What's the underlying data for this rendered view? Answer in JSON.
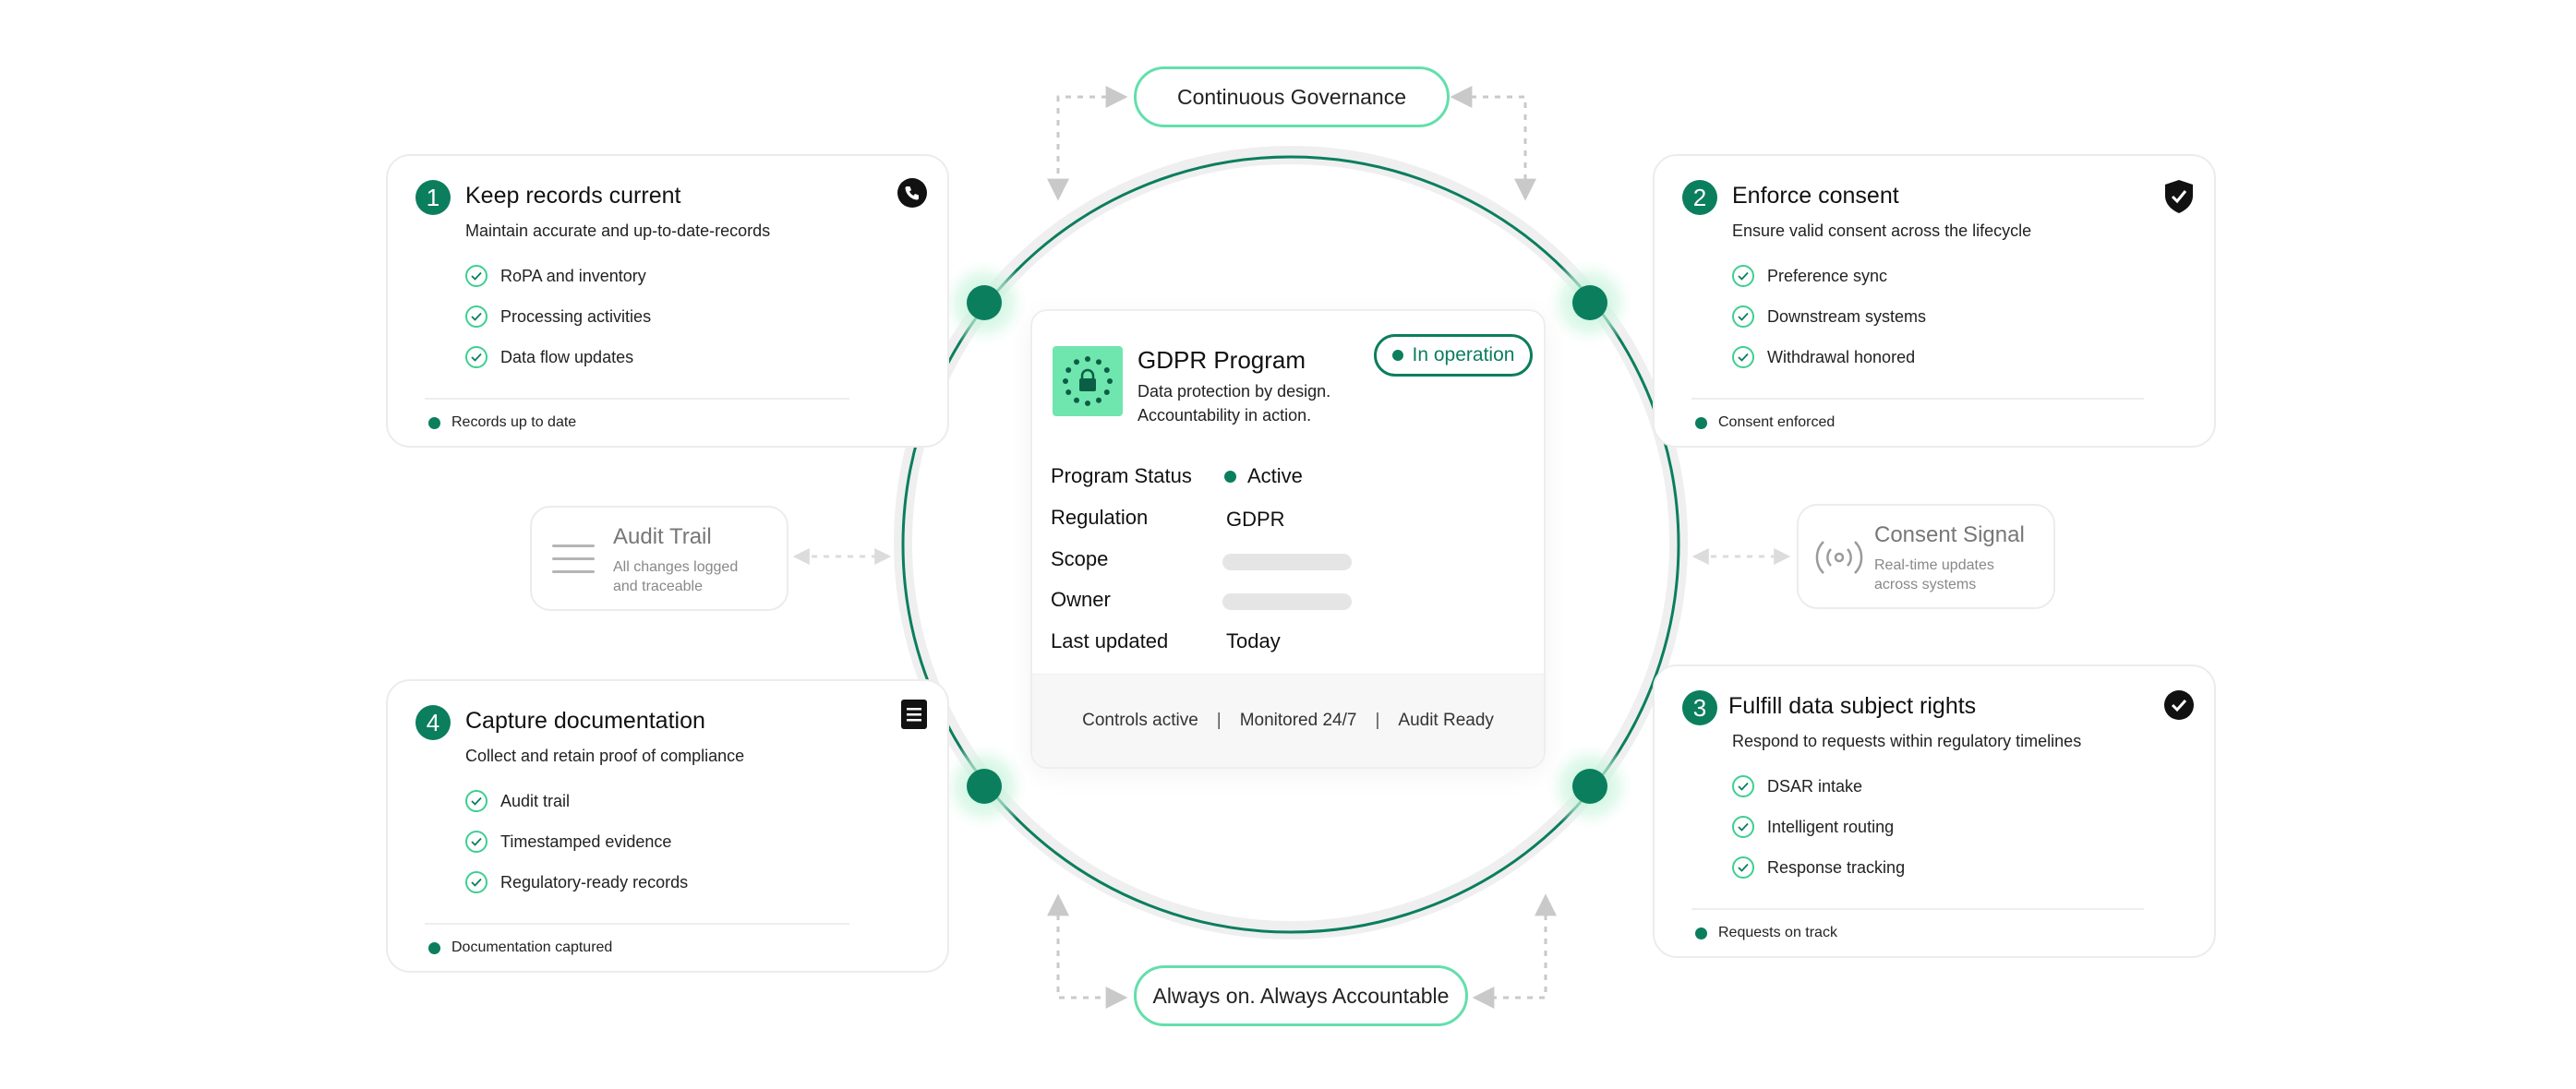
{
  "top_pill": "Continuous Governance",
  "bottom_pill": "Always on. Always Accountable",
  "cards": [
    {
      "number": "1",
      "title": "Keep records current",
      "subtitle": "Maintain accurate and up-to-date-records",
      "items": [
        "RoPA and inventory",
        "Processing activities",
        "Data flow updates"
      ],
      "footer": "Records up to date",
      "icon": "phone-icon"
    },
    {
      "number": "2",
      "title": "Enforce consent",
      "subtitle": "Ensure valid consent across the lifecycle",
      "items": [
        "Preference sync",
        "Downstream systems",
        "Withdrawal honored"
      ],
      "footer": "Consent enforced",
      "icon": "shield-check-icon"
    },
    {
      "number": "3",
      "title": "Fulfill data subject rights",
      "subtitle": "Respond to requests within regulatory timelines",
      "items": [
        "DSAR intake",
        "Intelligent routing",
        "Response tracking"
      ],
      "footer": "Requests on track",
      "icon": "check-circle-icon"
    },
    {
      "number": "4",
      "title": "Capture documentation",
      "subtitle": "Collect and retain proof of compliance",
      "items": [
        "Audit trail",
        "Timestamped evidence",
        "Regulatory-ready records"
      ],
      "footer": "Documentation captured",
      "icon": "document-icon"
    }
  ],
  "audit_trail": {
    "title": "Audit Trail",
    "subtitle_line1": "All changes logged",
    "subtitle_line2": "and traceable",
    "icon": "list-lines-icon"
  },
  "consent_signal": {
    "title": "Consent Signal",
    "subtitle_line1": "Real-time updates",
    "subtitle_line2": "across systems",
    "icon": "signal-broadcast-icon"
  },
  "program": {
    "title": "GDPR Program",
    "desc_line1": "Data protection by design.",
    "desc_line2": "Accountability in action.",
    "badge": "In operation",
    "logo_icon": "eu-stars-lock-icon",
    "rows": [
      {
        "label": "Program Status",
        "value": "Active"
      },
      {
        "label": "Regulation",
        "value": "GDPR"
      },
      {
        "label": "Scope",
        "value": ""
      },
      {
        "label": "Owner",
        "value": ""
      },
      {
        "label": "Last updated",
        "value": "Today"
      }
    ],
    "footer": [
      "Controls active",
      "Monitored 24/7",
      "Audit Ready"
    ],
    "footer_sep": "|"
  },
  "colors": {
    "accent": "#0b7e5e",
    "mint": "#63dfab",
    "glow": "#d8f7e8"
  }
}
